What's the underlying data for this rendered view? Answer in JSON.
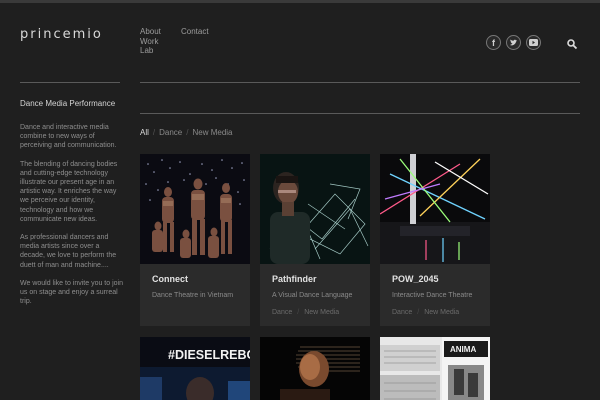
{
  "site": {
    "logo": "princemio"
  },
  "nav": {
    "col1": [
      "About",
      "Work",
      "Lab"
    ],
    "col2": [
      "Contact"
    ]
  },
  "social": [
    "f",
    "t",
    "yt"
  ],
  "sidebar": {
    "title": "Dance Media Performance",
    "paragraphs": [
      "Dance and interactive media combine to new ways of perceiving and communication.",
      "The blending of dancing bodies and cutting-edge technology illustrate our present age in an artistic way. It enriches the way we perceive our identity, technology and how we communicate new ideas.",
      "As professional dancers and media artists since over a decade, we love to perform the duett of man and machine....",
      "We would like to invite you to join us on stage and enjoy a surreal trip."
    ]
  },
  "filters": [
    "All",
    "Dance",
    "New Media"
  ],
  "cards": [
    {
      "title": "Connect",
      "subtitle": "Dance Theatre in Vietnam",
      "tags": []
    },
    {
      "title": "Pathfinder",
      "subtitle": "A Visual Dance Language",
      "tags": [
        "Dance",
        "New Media"
      ]
    },
    {
      "title": "POW_2045",
      "subtitle": "Interactive Dance Theatre",
      "tags": [
        "Dance",
        "New Media"
      ]
    }
  ],
  "row2": {
    "card1_text": "#DIESELREBOOT",
    "card3_text": "ANIMA"
  },
  "colors": {
    "background": "#1f1f1f",
    "card": "#2b2b2b",
    "text": "#9a9a9a"
  }
}
